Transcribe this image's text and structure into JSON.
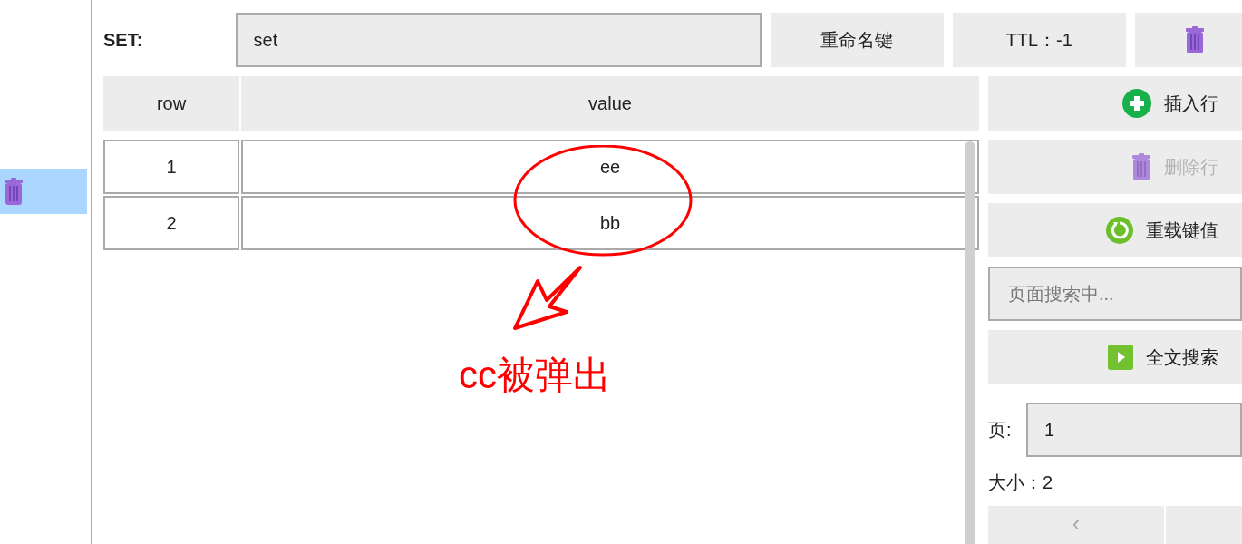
{
  "sidebar": {
    "items": [
      {
        "selected": true
      }
    ]
  },
  "key": {
    "type_label": "SET:",
    "name": "set",
    "rename_button": "重命名键",
    "ttl_button": "TTL：-1"
  },
  "table": {
    "columns": [
      "row",
      "value"
    ],
    "rows": [
      {
        "row": "1",
        "value": "ee"
      },
      {
        "row": "2",
        "value": "bb"
      }
    ]
  },
  "actions": [
    {
      "kind": "insert",
      "label": "插入行",
      "disabled": false
    },
    {
      "kind": "delete",
      "label": "删除行",
      "disabled": true
    },
    {
      "kind": "reload",
      "label": "重载键值",
      "disabled": false
    }
  ],
  "page_search": {
    "placeholder": "页面搜索中..."
  },
  "fulltext_button": "全文搜索",
  "page": {
    "label": "页:",
    "value": "1"
  },
  "size": "大小：2",
  "pager": [
    "‹"
  ],
  "annotation": {
    "text": "cc被弹出"
  }
}
